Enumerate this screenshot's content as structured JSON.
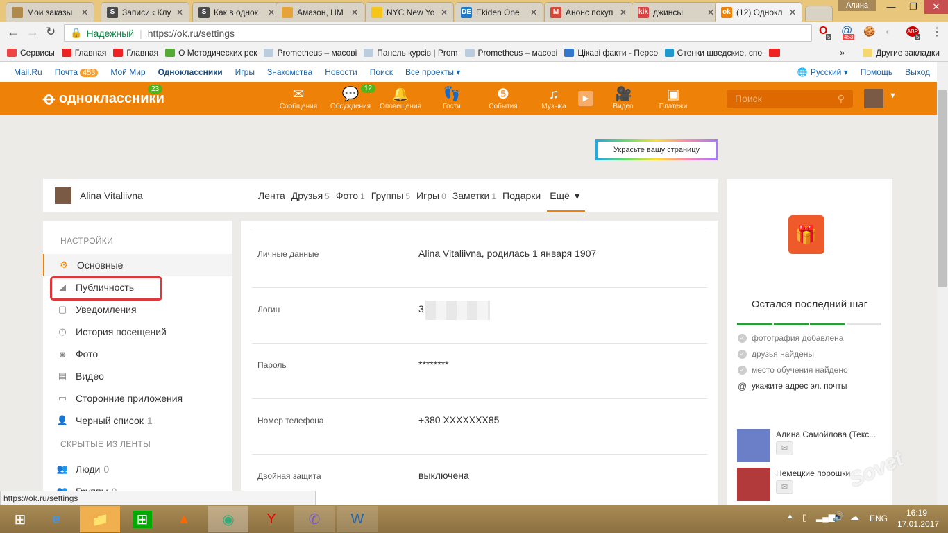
{
  "browser": {
    "tabs": [
      {
        "title": "Мои заказы",
        "fav": "#b08a4a"
      },
      {
        "title": "Записи ‹ Клу",
        "fav": "#4a4a4a",
        "letter": "S"
      },
      {
        "title": "Как в однок",
        "fav": "#4a4a4a",
        "letter": "S"
      },
      {
        "title": "Амазон, НМ",
        "fav": "#e5a33a"
      },
      {
        "title": "NYC New Yo",
        "fav": "#f5c518"
      },
      {
        "title": "Ekiden One",
        "fav": "#1e7ac8",
        "letter": "DE"
      },
      {
        "title": "Анонс покуп",
        "fav": "#d44638",
        "letter": "M"
      },
      {
        "title": "джинсы",
        "fav": "#e04040",
        "letter": "kik"
      },
      {
        "title": "(12) Однокл",
        "fav": "#ee8208",
        "letter": "ok"
      }
    ],
    "user": "Алина",
    "secure_label": "Надежный",
    "url": "https://ok.ru/settings",
    "ext_badges": {
      "opera": "5",
      "mail": "453",
      "abp": "5"
    },
    "bookmarks": [
      "Сервисы",
      "Главная",
      "Главная",
      "О Методических рек",
      "Prometheus – масові",
      "Панель курсів | Prom",
      "Prometheus – масові",
      "Цікаві факти - Персо",
      "Стенки шведские, спо"
    ],
    "other_bookmarks": "Другие закладки",
    "status_url": "https://ok.ru/settings"
  },
  "mailbar": {
    "items": [
      "Mail.Ru",
      "Почта",
      "Мой Мир",
      "Одноклассники",
      "Игры",
      "Знакомства",
      "Новости",
      "Поиск",
      "Все проекты ▾"
    ],
    "mail_count": "453",
    "lang": "Русский ▾",
    "help": "Помощь",
    "logout": "Выход"
  },
  "okheader": {
    "logo": "одноклассники",
    "logo_badge": "23",
    "nav": [
      {
        "label": "Сообщения",
        "icon": "✉"
      },
      {
        "label": "Обсуждения",
        "icon": "💬",
        "badge": "12"
      },
      {
        "label": "Оповещения",
        "icon": "🔔"
      },
      {
        "label": "Гости",
        "icon": "👣"
      },
      {
        "label": "События",
        "icon": "❺"
      },
      {
        "label": "Музыка",
        "icon": "♫"
      },
      {
        "label": "Видео",
        "icon": "🎥"
      },
      {
        "label": "Платежи",
        "icon": "▣"
      }
    ],
    "search_placeholder": "Поиск"
  },
  "decorate": "Украсьте вашу страницу",
  "profile": {
    "name": "Alina Vitaliivna",
    "tabs": [
      {
        "label": "Лента"
      },
      {
        "label": "Друзья",
        "count": "5"
      },
      {
        "label": "Фото",
        "count": "1"
      },
      {
        "label": "Группы",
        "count": "5"
      },
      {
        "label": "Игры",
        "count": "0"
      },
      {
        "label": "Заметки",
        "count": "1"
      },
      {
        "label": "Подарки"
      },
      {
        "label": "Ещё ▼"
      }
    ]
  },
  "settings": {
    "heading": "НАСТРОЙКИ",
    "items": [
      {
        "label": "Основные",
        "icon": "⚙"
      },
      {
        "label": "Публичность",
        "icon": "◢"
      },
      {
        "label": "Уведомления",
        "icon": "▢"
      },
      {
        "label": "История посещений",
        "icon": "◷"
      },
      {
        "label": "Фото",
        "icon": "◙"
      },
      {
        "label": "Видео",
        "icon": "▤"
      },
      {
        "label": "Сторонние приложения",
        "icon": "▭"
      },
      {
        "label": "Черный список",
        "icon": "👤",
        "count": "1"
      }
    ],
    "hidden_heading": "СКРЫТЫЕ ИЗ ЛЕНТЫ",
    "hidden": [
      {
        "label": "Люди",
        "count": "0"
      },
      {
        "label": "Группы",
        "count": "0"
      }
    ]
  },
  "details": [
    {
      "key": "Личные данные",
      "value": "Alina Vitaliivna, родилась 1 января 1907"
    },
    {
      "key": "Логин",
      "value": "3"
    },
    {
      "key": "Пароль",
      "value": "********"
    },
    {
      "key": "Номер телефона",
      "value": "+380 XXXXXXX85"
    },
    {
      "key": "Двойная защита",
      "value": "выключена"
    }
  ],
  "steps": {
    "title": "Остался последний шаг",
    "progress_segments_done": 3,
    "progress_segments_total": 4,
    "items": [
      {
        "label": "фотография добавлена",
        "done": true
      },
      {
        "label": "друзья найдены",
        "done": true
      },
      {
        "label": "место обучения найдено",
        "done": true
      },
      {
        "label": "укажите адрес эл. почты",
        "done": false
      }
    ]
  },
  "friends": [
    {
      "name": "Алина Самойлова (Текс..."
    },
    {
      "name": "Немецкие порошки"
    }
  ],
  "tray": {
    "lang": "ENG",
    "time": "16:19",
    "date": "17.01.2017"
  }
}
